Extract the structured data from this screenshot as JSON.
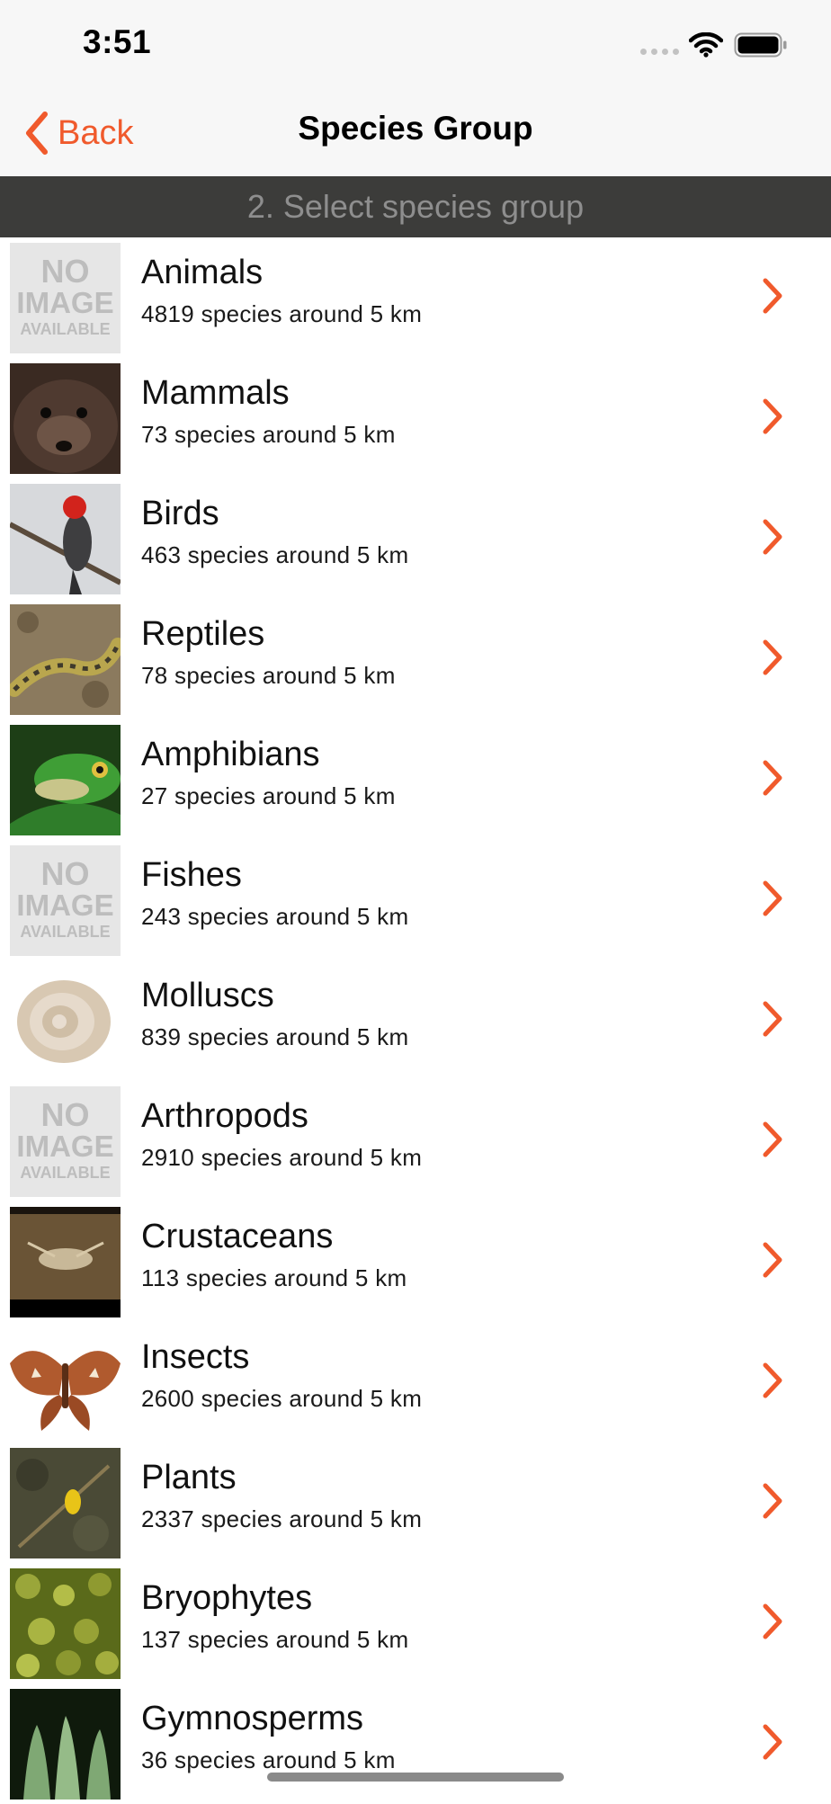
{
  "status_bar": {
    "time": "3:51"
  },
  "nav": {
    "back_label": "Back",
    "title": "Species Group"
  },
  "section_header": "2. Select species group",
  "no_image": {
    "line1": "NO",
    "line2": "IMAGE",
    "line3": "AVAILABLE"
  },
  "colors": {
    "accent": "#f05a2c",
    "header_bg": "#3c3c3a",
    "header_text": "#8e8e8e"
  },
  "groups": [
    {
      "name": "Animals",
      "count": "4819 species around 5 km",
      "image": "no-image"
    },
    {
      "name": "Mammals",
      "count": "73 species around 5 km",
      "image": "mammal"
    },
    {
      "name": "Birds",
      "count": "463 species around 5 km",
      "image": "bird"
    },
    {
      "name": "Reptiles",
      "count": "78 species around 5 km",
      "image": "reptile"
    },
    {
      "name": "Amphibians",
      "count": "27 species around 5 km",
      "image": "amphibian"
    },
    {
      "name": "Fishes",
      "count": "243 species around 5 km",
      "image": "no-image"
    },
    {
      "name": "Molluscs",
      "count": "839 species around 5 km",
      "image": "mollusc"
    },
    {
      "name": "Arthropods",
      "count": "2910 species around 5 km",
      "image": "no-image"
    },
    {
      "name": "Crustaceans",
      "count": "113 species around 5 km",
      "image": "crustacean"
    },
    {
      "name": "Insects",
      "count": "2600 species around 5 km",
      "image": "insect"
    },
    {
      "name": "Plants",
      "count": "2337 species around 5 km",
      "image": "plant"
    },
    {
      "name": "Bryophytes",
      "count": "137 species around 5 km",
      "image": "bryophyte"
    },
    {
      "name": "Gymnosperms",
      "count": "36 species around 5 km",
      "image": "gymnosperm"
    }
  ]
}
